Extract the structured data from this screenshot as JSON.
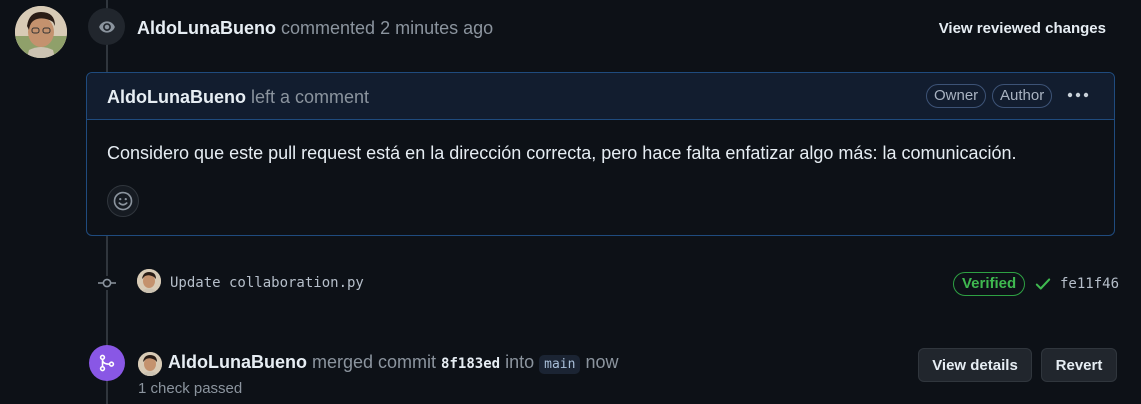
{
  "review_event": {
    "author": "AldoLunaBueno",
    "action": "commented",
    "time": "2 minutes ago",
    "view_reviewed_label": "View reviewed changes"
  },
  "comment": {
    "author": "AldoLunaBueno",
    "action": "left a comment",
    "badges": [
      "Owner",
      "Author"
    ],
    "body": "Considero que este pull request está en la dirección correcta, pero hace falta enfatizar algo más: la comunicación."
  },
  "commit": {
    "message": "Update collaboration.py",
    "verified_label": "Verified",
    "sha": "fe11f46"
  },
  "merge_event": {
    "author": "AldoLunaBueno",
    "action": "merged commit",
    "commit_sha": "8f183ed",
    "into_label": "into",
    "branch": "main",
    "time": "now",
    "checks": "1 check passed",
    "view_details_label": "View details",
    "revert_label": "Revert"
  },
  "colors": {
    "background": "#0d1117",
    "accent_border": "#1f4b7e",
    "verified_green": "#3fb950",
    "merge_purple": "#8957e5"
  },
  "icons": {
    "review": "eye-icon",
    "kebab": "kebab-horizontal-icon",
    "reaction": "smiley-icon",
    "commit": "git-commit-icon",
    "verified_check": "check-icon",
    "merge": "git-merge-icon"
  }
}
